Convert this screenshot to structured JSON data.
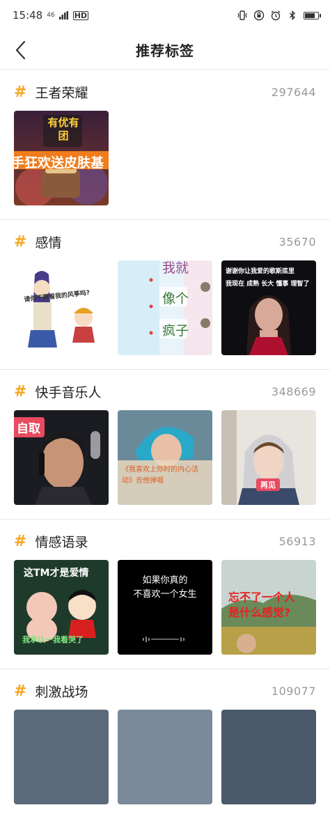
{
  "status": {
    "time": "15:48",
    "network": "46",
    "signal": "HD"
  },
  "nav": {
    "title": "推荐标签"
  },
  "sections": [
    {
      "tag": "王者荣耀",
      "count": "297644"
    },
    {
      "tag": "感情",
      "count": "35670"
    },
    {
      "tag": "快手音乐人",
      "count": "348669"
    },
    {
      "tag": "情感语录",
      "count": "56913"
    },
    {
      "tag": "刺激战场",
      "count": "109077"
    }
  ],
  "thumbs": {
    "s1t1": {
      "logo": "有优有团",
      "banner": "手狂欢送皮肤基"
    },
    "s2t1": {
      "caption": "请你不要看我的风筝吗?"
    },
    "s2t2": {
      "line1": "我就",
      "line2": "像个",
      "line3": "疯子"
    },
    "s2t3": {
      "line1": "谢谢你让我爱的歌斯底里",
      "line2": "我现在 成熟 长大 懂事 理智了"
    },
    "s3t1": {
      "badge": "自取"
    },
    "s3t2": {
      "caption": "《我喜欢上你时的内心活动》吉他弹唱"
    },
    "s3t3": {
      "badge": "再见"
    },
    "s4t1": {
      "top": "这TM才是爱情",
      "bottom": "我承认一我看哭了"
    },
    "s4t2": {
      "line1": "如果你真的",
      "line2": "不喜欢一个女生"
    },
    "s4t3": {
      "line1": "忘不了一个人",
      "line2": "是什么感觉?"
    }
  },
  "colors": {
    "accent": "#f5a623",
    "count": "#999999",
    "divider": "#e8e8e8"
  }
}
